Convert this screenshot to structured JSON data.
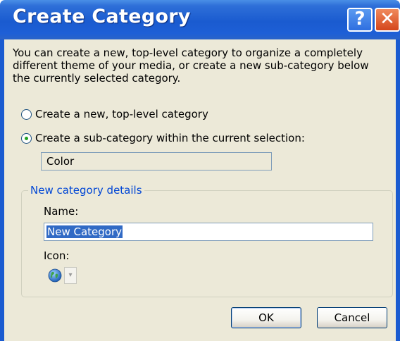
{
  "dialog": {
    "title": "Create Category",
    "help_button": "?",
    "close_button": "✕"
  },
  "description": "You can create a new, top-level category to organize a completely different theme of your media, or create a new sub-category below the currently selected category.",
  "options": [
    {
      "label": "Create a new, top-level category",
      "selected": false
    },
    {
      "label": "Create a sub-category within the current selection:",
      "selected": true
    }
  ],
  "current_selection": "Color",
  "details": {
    "group_label": "New category details",
    "name_label": "Name:",
    "name_value": "New Category",
    "icon_label": "Icon:",
    "icon_name": "globe-icon"
  },
  "buttons": {
    "ok": "OK",
    "cancel": "Cancel"
  },
  "colors": {
    "titlebar": "#1a5bd0",
    "face": "#ece9d8",
    "group_label": "#0046d5",
    "selection": "#316ac5"
  }
}
